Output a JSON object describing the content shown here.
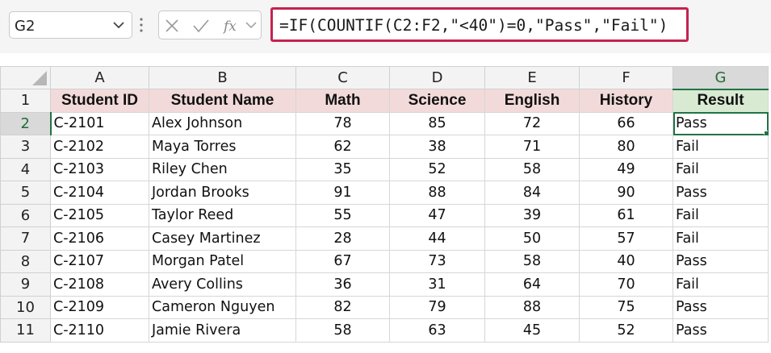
{
  "name_box": {
    "value": "G2"
  },
  "formula_bar": {
    "formula": "=IF(COUNTIF(C2:F2,\"<40\")=0,\"Pass\",\"Fail\")"
  },
  "columns": [
    "A",
    "B",
    "C",
    "D",
    "E",
    "F",
    "G"
  ],
  "selected_column": "G",
  "header_row": {
    "row_number": "1",
    "cells": [
      "Student ID",
      "Student Name",
      "Math",
      "Science",
      "English",
      "History",
      "Result"
    ]
  },
  "rows": [
    {
      "row_number": "2",
      "cells": [
        "C-2101",
        "Alex Johnson",
        "78",
        "85",
        "72",
        "66",
        "Pass"
      ]
    },
    {
      "row_number": "3",
      "cells": [
        "C-2102",
        "Maya Torres",
        "62",
        "38",
        "71",
        "80",
        "Fail"
      ]
    },
    {
      "row_number": "4",
      "cells": [
        "C-2103",
        "Riley Chen",
        "35",
        "52",
        "58",
        "49",
        "Fail"
      ]
    },
    {
      "row_number": "5",
      "cells": [
        "C-2104",
        "Jordan Brooks",
        "91",
        "88",
        "84",
        "90",
        "Pass"
      ]
    },
    {
      "row_number": "6",
      "cells": [
        "C-2105",
        "Taylor Reed",
        "55",
        "47",
        "39",
        "61",
        "Fail"
      ]
    },
    {
      "row_number": "7",
      "cells": [
        "C-2106",
        "Casey Martinez",
        "28",
        "44",
        "50",
        "57",
        "Fail"
      ]
    },
    {
      "row_number": "8",
      "cells": [
        "C-2107",
        "Morgan Patel",
        "67",
        "73",
        "58",
        "40",
        "Pass"
      ]
    },
    {
      "row_number": "9",
      "cells": [
        "C-2108",
        "Avery Collins",
        "36",
        "31",
        "64",
        "70",
        "Fail"
      ]
    },
    {
      "row_number": "10",
      "cells": [
        "C-2109",
        "Cameron Nguyen",
        "82",
        "79",
        "88",
        "75",
        "Pass"
      ]
    },
    {
      "row_number": "11",
      "cells": [
        "C-2110",
        "Jamie Rivera",
        "58",
        "63",
        "45",
        "52",
        "Pass"
      ]
    }
  ],
  "active_cell": "G2",
  "icons": {
    "cancel": "x-icon",
    "enter": "check-icon",
    "function": "fx-icon",
    "dropdown": "chevron-down-icon"
  },
  "colors": {
    "header_fill": "#f3dada",
    "result_header_fill": "#d9ead3",
    "selection": "#217346",
    "formula_highlight": "#c5234f"
  }
}
